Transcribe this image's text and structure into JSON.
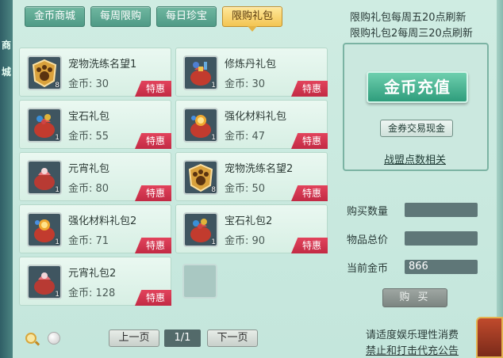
{
  "left_strip": {
    "chars": [
      "商",
      "城"
    ]
  },
  "tabs": [
    {
      "label": "金币商城",
      "active": false
    },
    {
      "label": "每周限购",
      "active": false
    },
    {
      "label": "每日珍宝",
      "active": false
    },
    {
      "label": "限购礼包",
      "active": true
    }
  ],
  "notices": [
    "限购礼包每周五20点刷新",
    "限购礼包2每周三20点刷新"
  ],
  "items": [
    {
      "name": "宠物洗练名望1",
      "price": "金币: 30",
      "qty": "8",
      "icon": "paw-badge-icon",
      "deal": "特惠"
    },
    {
      "name": "修炼丹礼包",
      "price": "金币: 30",
      "qty": "1",
      "icon": "gift-bag-icon",
      "deal": "特惠"
    },
    {
      "name": "宝石礼包",
      "price": "金币: 55",
      "qty": "1",
      "icon": "gift-bag-icon",
      "deal": "特惠"
    },
    {
      "name": "强化材料礼包",
      "price": "金币: 47",
      "qty": "1",
      "icon": "gift-bag-icon",
      "deal": "特惠"
    },
    {
      "name": "元宵礼包",
      "price": "金币: 80",
      "qty": "1",
      "icon": "gift-bag-icon",
      "deal": "特惠"
    },
    {
      "name": "宠物洗练名望2",
      "price": "金币: 50",
      "qty": "8",
      "icon": "paw-badge-icon",
      "deal": "特惠"
    },
    {
      "name": "强化材料礼包2",
      "price": "金币: 71",
      "qty": "1",
      "icon": "gift-bag-icon",
      "deal": "特惠"
    },
    {
      "name": "宝石礼包2",
      "price": "金币: 90",
      "qty": "1",
      "icon": "gift-bag-icon",
      "deal": "特惠"
    },
    {
      "name": "元宵礼包2",
      "price": "金币: 128",
      "qty": "1",
      "icon": "gift-bag-icon",
      "deal": "特惠"
    }
  ],
  "pager": {
    "prev": "上一页",
    "page": "1/1",
    "next": "下一页"
  },
  "panel": {
    "recharge": "金币充值",
    "voucher": "金券交易现金",
    "alliance": "战盟点数相关"
  },
  "purchase": {
    "qty_label": "购买数量",
    "qty_value": "",
    "total_label": "物品总价",
    "total_value": "",
    "gold_label": "当前金币",
    "gold_value": "866",
    "buy_button": "购 买"
  },
  "footer": {
    "line1": "请适度娱乐理性消费",
    "line2": "禁止和打击代充公告"
  },
  "colors": {
    "accent_tab": "#f3c552",
    "deal_red": "#c22a44",
    "recharge_green": "#2f9d7c"
  }
}
